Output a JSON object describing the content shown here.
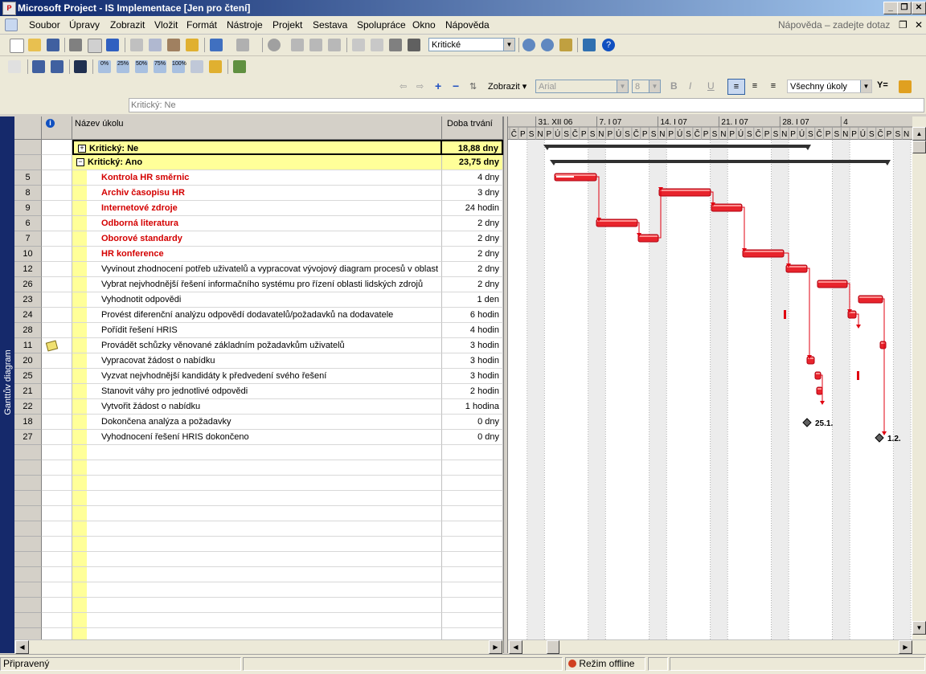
{
  "window": {
    "title": "Microsoft Project - IS Implementace [Jen pro čtení]",
    "controls": [
      "_",
      "❐",
      "✕"
    ]
  },
  "menu": {
    "items": [
      "Soubor",
      "Úpravy",
      "Zobrazit",
      "Vložit",
      "Formát",
      "Nástroje",
      "Projekt",
      "Sestava",
      "Spolupráce",
      "Okno",
      "Nápověda"
    ],
    "help_placeholder": "Nápověda – zadejte dotaz"
  },
  "toolbar": {
    "filter_value": "Kritické",
    "show_label": "Zobrazit",
    "font_value": "Arial",
    "size_value": "8",
    "tasks_filter": "Všechny úkoly",
    "progress_labels": [
      "0%",
      "25%",
      "50%",
      "75%",
      "100%"
    ]
  },
  "entry_bar": {
    "value": "Kritický: Ne"
  },
  "side_tab": "Ganttův diagram",
  "table": {
    "headers": {
      "name": "Název úkolu",
      "duration": "Doba trvání"
    },
    "rows": [
      {
        "id": "",
        "name": "Kritický: Ne",
        "duration": "18,88 dny",
        "type": "group",
        "toggle": "+"
      },
      {
        "id": "",
        "name": "Kritický: Ano",
        "duration": "23,75 dny",
        "type": "group",
        "toggle": "−"
      },
      {
        "id": "5",
        "name": "Kontrola HR směrnic",
        "duration": "4 dny",
        "type": "critical"
      },
      {
        "id": "8",
        "name": "Archiv časopisu HR",
        "duration": "3 dny",
        "type": "critical"
      },
      {
        "id": "9",
        "name": "Internetové zdroje",
        "duration": "24 hodin",
        "type": "critical"
      },
      {
        "id": "6",
        "name": "Odborná literatura",
        "duration": "2 dny",
        "type": "critical"
      },
      {
        "id": "7",
        "name": "Oborové standardy",
        "duration": "2 dny",
        "type": "critical"
      },
      {
        "id": "10",
        "name": "HR konference",
        "duration": "2 dny",
        "type": "critical"
      },
      {
        "id": "12",
        "name": "Vyvinout zhodnocení potřeb uživatelů a vypracovat vývojový diagram procesů v oblast",
        "duration": "2 dny",
        "type": "task"
      },
      {
        "id": "26",
        "name": "Vybrat nejvhodnější řešení informačního systému pro řízení oblasti lidských zdrojů",
        "duration": "2 dny",
        "type": "task"
      },
      {
        "id": "23",
        "name": "Vyhodnotit odpovědi",
        "duration": "1 den",
        "type": "task"
      },
      {
        "id": "24",
        "name": "Provést diferenční analýzu odpovědí dodavatelů/požadavků na dodavatele",
        "duration": "6 hodin",
        "type": "task"
      },
      {
        "id": "28",
        "name": "Pořídit řešení HRIS",
        "duration": "4 hodin",
        "type": "task"
      },
      {
        "id": "11",
        "name": "Provádět schůzky věnované základním požadavkům uživatelů",
        "duration": "3 hodin",
        "type": "task",
        "note": true
      },
      {
        "id": "20",
        "name": "Vypracovat žádost o nabídku",
        "duration": "3 hodin",
        "type": "task"
      },
      {
        "id": "25",
        "name": "Vyzvat nejvhodnější kandidáty k předvedení svého řešení",
        "duration": "3 hodin",
        "type": "task"
      },
      {
        "id": "21",
        "name": "Stanovit váhy pro jednotlivé odpovědi",
        "duration": "2 hodin",
        "type": "task"
      },
      {
        "id": "22",
        "name": "Vytvořit žádost o nabídku",
        "duration": "1 hodina",
        "type": "task"
      },
      {
        "id": "18",
        "name": "Dokončena analýza a požadavky",
        "duration": "0 dny",
        "type": "task"
      },
      {
        "id": "27",
        "name": "Vyhodnocení řešení HRIS dokončeno",
        "duration": "0 dny",
        "type": "task"
      }
    ]
  },
  "gantt": {
    "weeks": [
      "31. XII 06",
      "7. I 07",
      "14. I 07",
      "21. I 07",
      "28. I 07",
      "4"
    ],
    "days": [
      "Č",
      "P",
      "S",
      "N",
      "P",
      "Ú",
      "S",
      "Č",
      "P",
      "S",
      "N",
      "P",
      "Ú",
      "S",
      "Č",
      "P",
      "S",
      "N",
      "P",
      "Ú",
      "S",
      "Č",
      "P",
      "S",
      "N",
      "P",
      "Ú",
      "S",
      "Č",
      "P",
      "S",
      "N",
      "P",
      "Ú",
      "S",
      "Č",
      "P",
      "S",
      "N",
      "P",
      "Ú",
      "S",
      "Č",
      "P",
      "S",
      "N"
    ],
    "milestones": [
      {
        "row": 18,
        "label": "25.1."
      },
      {
        "row": 19,
        "label": "1.2."
      }
    ]
  },
  "status": {
    "left": "Připravený",
    "mode": "Režim offline"
  }
}
